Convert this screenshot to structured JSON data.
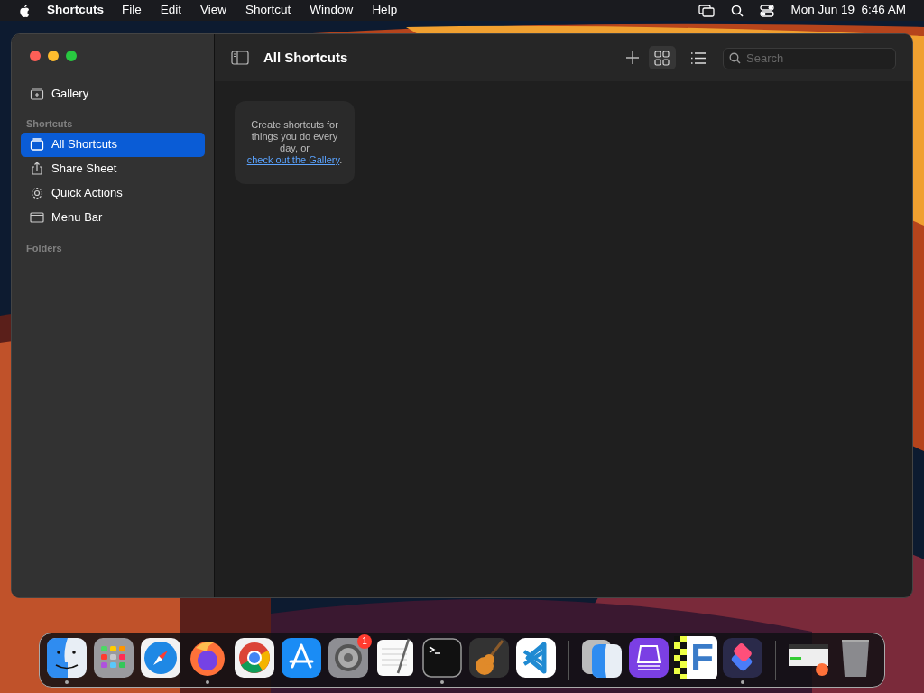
{
  "menu_bar": {
    "app_name": "Shortcuts",
    "menus": [
      "File",
      "Edit",
      "View",
      "Shortcut",
      "Window",
      "Help"
    ],
    "clock": "Mon Jun 19  6:46 AM"
  },
  "window": {
    "title": "All Shortcuts",
    "search": {
      "placeholder": "Search"
    },
    "view_modes": [
      {
        "kind": "grid",
        "selected": true
      },
      {
        "kind": "list",
        "selected": false
      }
    ]
  },
  "sidebar": {
    "top_items": [
      {
        "label": "Gallery",
        "kind": "gallery",
        "selected": false
      }
    ],
    "sections": [
      {
        "title": "Shortcuts",
        "items": [
          {
            "label": "All Shortcuts",
            "kind": "stack",
            "selected": true
          },
          {
            "label": "Share Sheet",
            "kind": "share",
            "selected": false
          },
          {
            "label": "Quick Actions",
            "kind": "gear",
            "selected": false
          },
          {
            "label": "Menu Bar",
            "kind": "menubar",
            "selected": false
          }
        ]
      },
      {
        "title": "Folders"
      }
    ]
  },
  "empty_state": {
    "text": "Create shortcuts for things you do every day, or ",
    "link": "check out the Gallery",
    "end": "."
  },
  "dock": [
    {
      "kind": "finder",
      "running": true
    },
    {
      "kind": "launchpad",
      "running": false
    },
    {
      "kind": "safari",
      "running": false
    },
    {
      "kind": "firefox",
      "running": true
    },
    {
      "kind": "chrome",
      "running": false
    },
    {
      "kind": "appstore",
      "running": false
    },
    {
      "kind": "settings",
      "running": false,
      "badge": "1"
    },
    {
      "kind": "textedit",
      "running": false
    },
    {
      "kind": "terminal",
      "running": true
    },
    {
      "kind": "garageband",
      "running": false
    },
    {
      "kind": "vscode",
      "running": false
    },
    {
      "kind": "separator"
    },
    {
      "kind": "migration",
      "running": false
    },
    {
      "kind": "disk",
      "running": false
    },
    {
      "kind": "letter",
      "running": false,
      "glyph": "F"
    },
    {
      "kind": "shortcuts",
      "running": true
    },
    {
      "kind": "separator"
    },
    {
      "kind": "window_thumb",
      "running": false
    },
    {
      "kind": "trash",
      "running": false
    }
  ]
}
